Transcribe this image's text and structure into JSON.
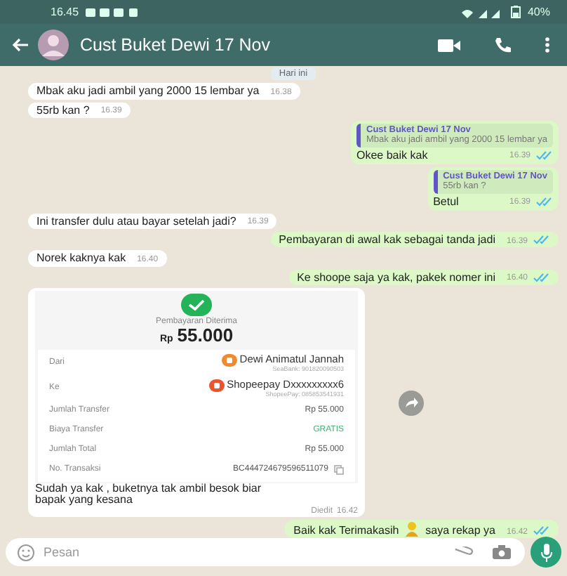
{
  "status_bar": {
    "time": "16.45",
    "battery": "40%"
  },
  "header": {
    "title": "Cust Buket Dewi 17 Nov"
  },
  "date_chip": "Hari ini",
  "messages": [
    {
      "kind": "in",
      "text": "Mbak aku jadi ambil yang 2000 15 lembar ya",
      "time": "16.38"
    },
    {
      "kind": "in",
      "text": "55rb kan ?",
      "time": "16.39"
    },
    {
      "kind": "out",
      "quote": {
        "author": "Cust Buket Dewi 17 Nov",
        "text": "Mbak aku jadi ambil yang 2000 15 lembar ya"
      },
      "text": "Okee  baik kak",
      "time": "16.39",
      "read": true
    },
    {
      "kind": "out",
      "quote": {
        "author": "Cust Buket Dewi 17 Nov",
        "text": "55rb kan ?"
      },
      "text": "Betul",
      "time": "16.39",
      "read": true
    },
    {
      "kind": "in",
      "text": "Ini transfer dulu atau bayar setelah jadi?",
      "time": "16.39"
    },
    {
      "kind": "out",
      "text": "Pembayaran di awal kak sebagai tanda jadi",
      "time": "16.39",
      "read": true
    },
    {
      "kind": "in",
      "text": "Norek kaknya kak",
      "time": "16.40"
    },
    {
      "kind": "out",
      "text": "Ke shoope saja ya kak, pakek nomer ini",
      "time": "16.40",
      "read": true
    },
    {
      "kind": "receipt",
      "receipt": {
        "title": "Pembayaran Diterima",
        "currency": "Rp",
        "amount": "55.000",
        "parties": [
          {
            "label": "Dari",
            "name": "Dewi Animatul Jannah",
            "detail": "SeaBank: 901820090503"
          },
          {
            "label": "Ke",
            "name": "Shopeepay Dxxxxxxxxx6",
            "detail": "ShopeePay: 085853541931"
          }
        ],
        "rows": [
          {
            "label": "Jumlah Transfer",
            "value": "Rp 55.000",
            "accent": false
          },
          {
            "label": "Biaya Transfer",
            "value": "GRATIS",
            "accent": true
          },
          {
            "label": "Jumlah Total",
            "value": "Rp 55.000",
            "accent": false
          },
          {
            "label": "No. Transaksi",
            "value": "BC444724679596511079",
            "accent": false
          }
        ]
      },
      "text": "Sudah ya kak , buketnya tak ambil besok biar bapak yang kesana",
      "edited": "Diedit",
      "time": "16.42"
    },
    {
      "kind": "out",
      "text": "Baik kak Terimakasih",
      "text_after": "saya rekap ya",
      "time": "16.42",
      "read": true
    }
  ],
  "composer": {
    "placeholder": "Pesan"
  }
}
